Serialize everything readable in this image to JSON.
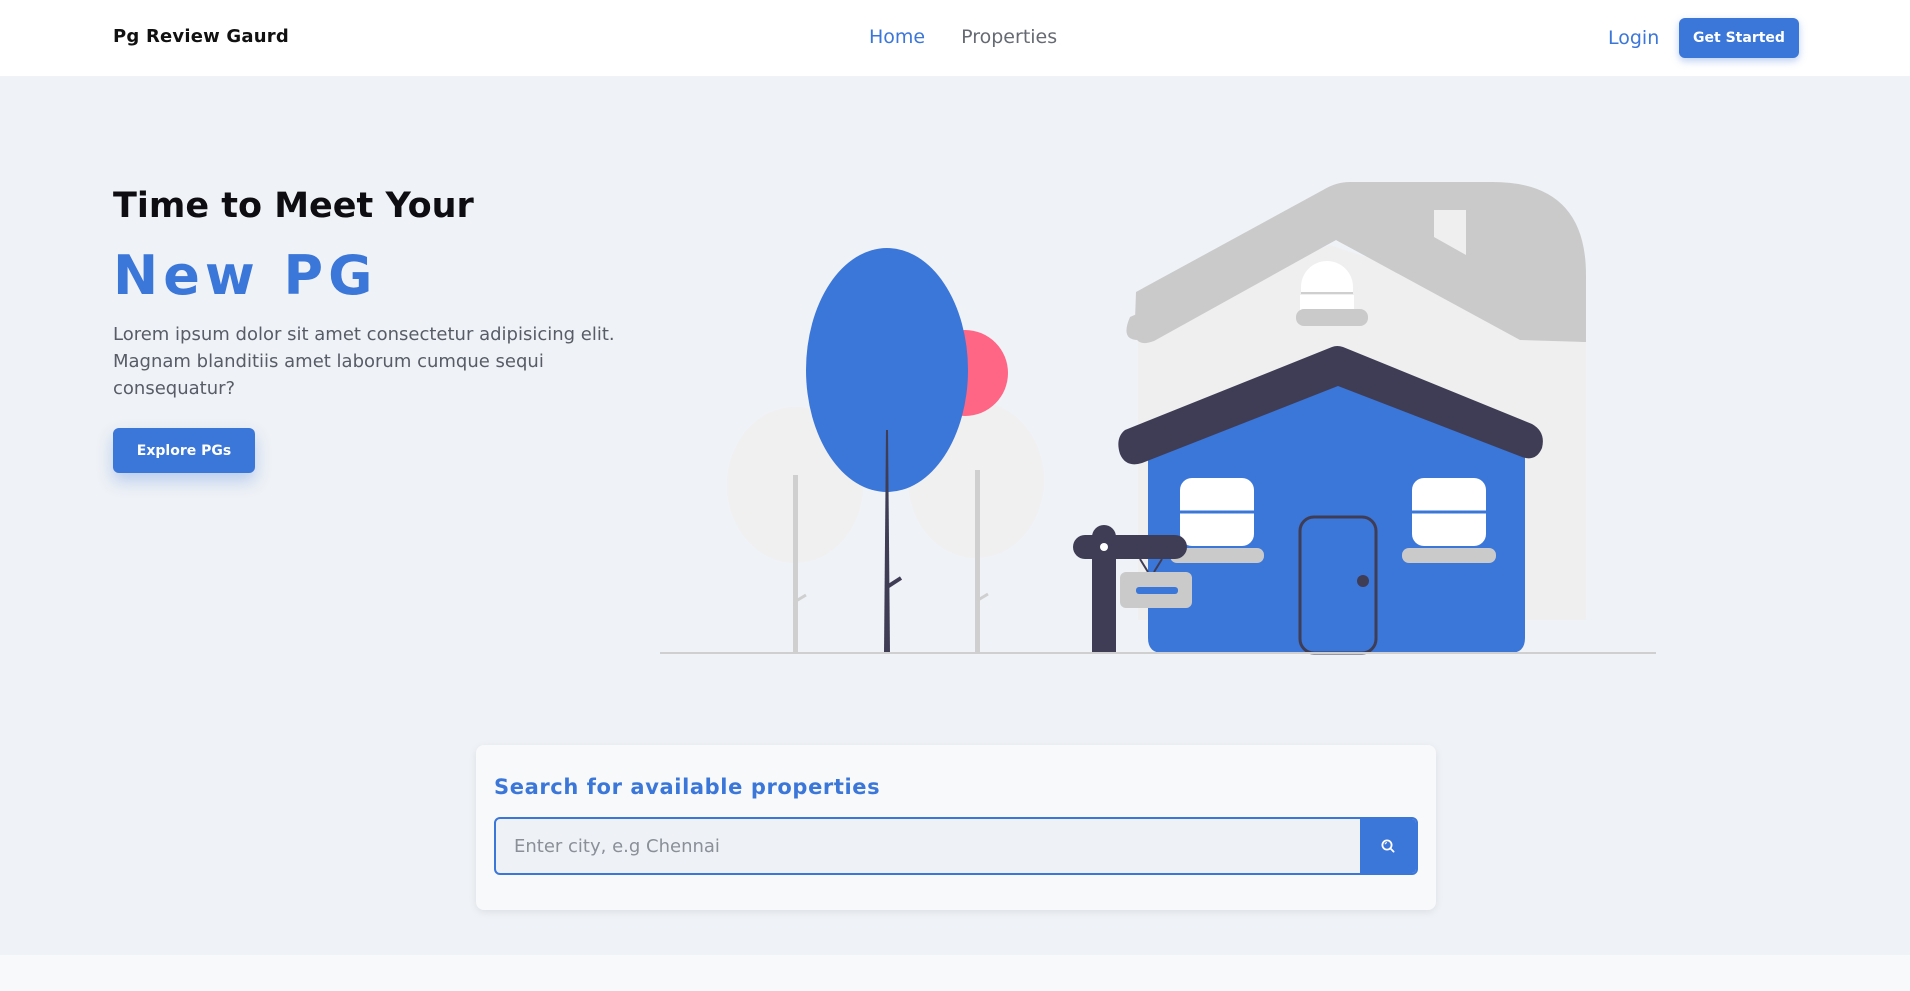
{
  "nav": {
    "brand": "Pg Review Gaurd",
    "links": [
      {
        "label": "Home",
        "active": true
      },
      {
        "label": "Properties",
        "active": false
      }
    ],
    "login": "Login",
    "get_started": "Get Started"
  },
  "hero": {
    "heading": "Time to Meet Your",
    "accent": "New PG",
    "description": "Lorem ipsum dolor sit amet consectetur adipisicing elit. Magnam blanditiis amet laborum cumque sequi consequatur?",
    "cta": "Explore PGs"
  },
  "search": {
    "title": "Search for available properties",
    "placeholder": "Enter city, e.g Chennai",
    "value": ""
  },
  "colors": {
    "primary": "#3b76d9",
    "background": "#eff2f6",
    "dark": "#3f3d56",
    "accent_pink": "#ff6584",
    "roof_grey": "#cacaca"
  },
  "icons": {
    "search_button": "search-icon",
    "illustration": "house-icon"
  }
}
